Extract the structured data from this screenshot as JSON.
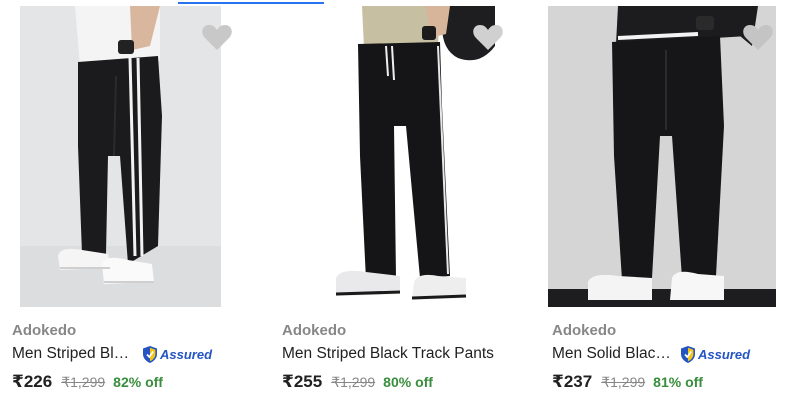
{
  "products": [
    {
      "brand": "Adokedo",
      "title": "Men Striped Black Track Pants",
      "assured_label": "Assured",
      "price": "₹226",
      "mrp": "₹1,299",
      "discount": "82% off",
      "wishlist_icon": "heart-icon"
    },
    {
      "brand": "Adokedo",
      "title": "Men Striped Black Track Pants",
      "assured_label": "",
      "price": "₹255",
      "mrp": "₹1,299",
      "discount": "80% off",
      "wishlist_icon": "heart-icon"
    },
    {
      "brand": "Adokedo",
      "title": "Men Solid Black Track Pants",
      "assured_label": "Assured",
      "price": "₹237",
      "mrp": "₹1,299",
      "discount": "81% off",
      "wishlist_icon": "heart-icon"
    }
  ],
  "colors": {
    "accent": "#2874f0",
    "discount": "#388e3c",
    "assured": "#2455c3",
    "brand_text": "#878787",
    "heart": "#c2c2c2"
  }
}
